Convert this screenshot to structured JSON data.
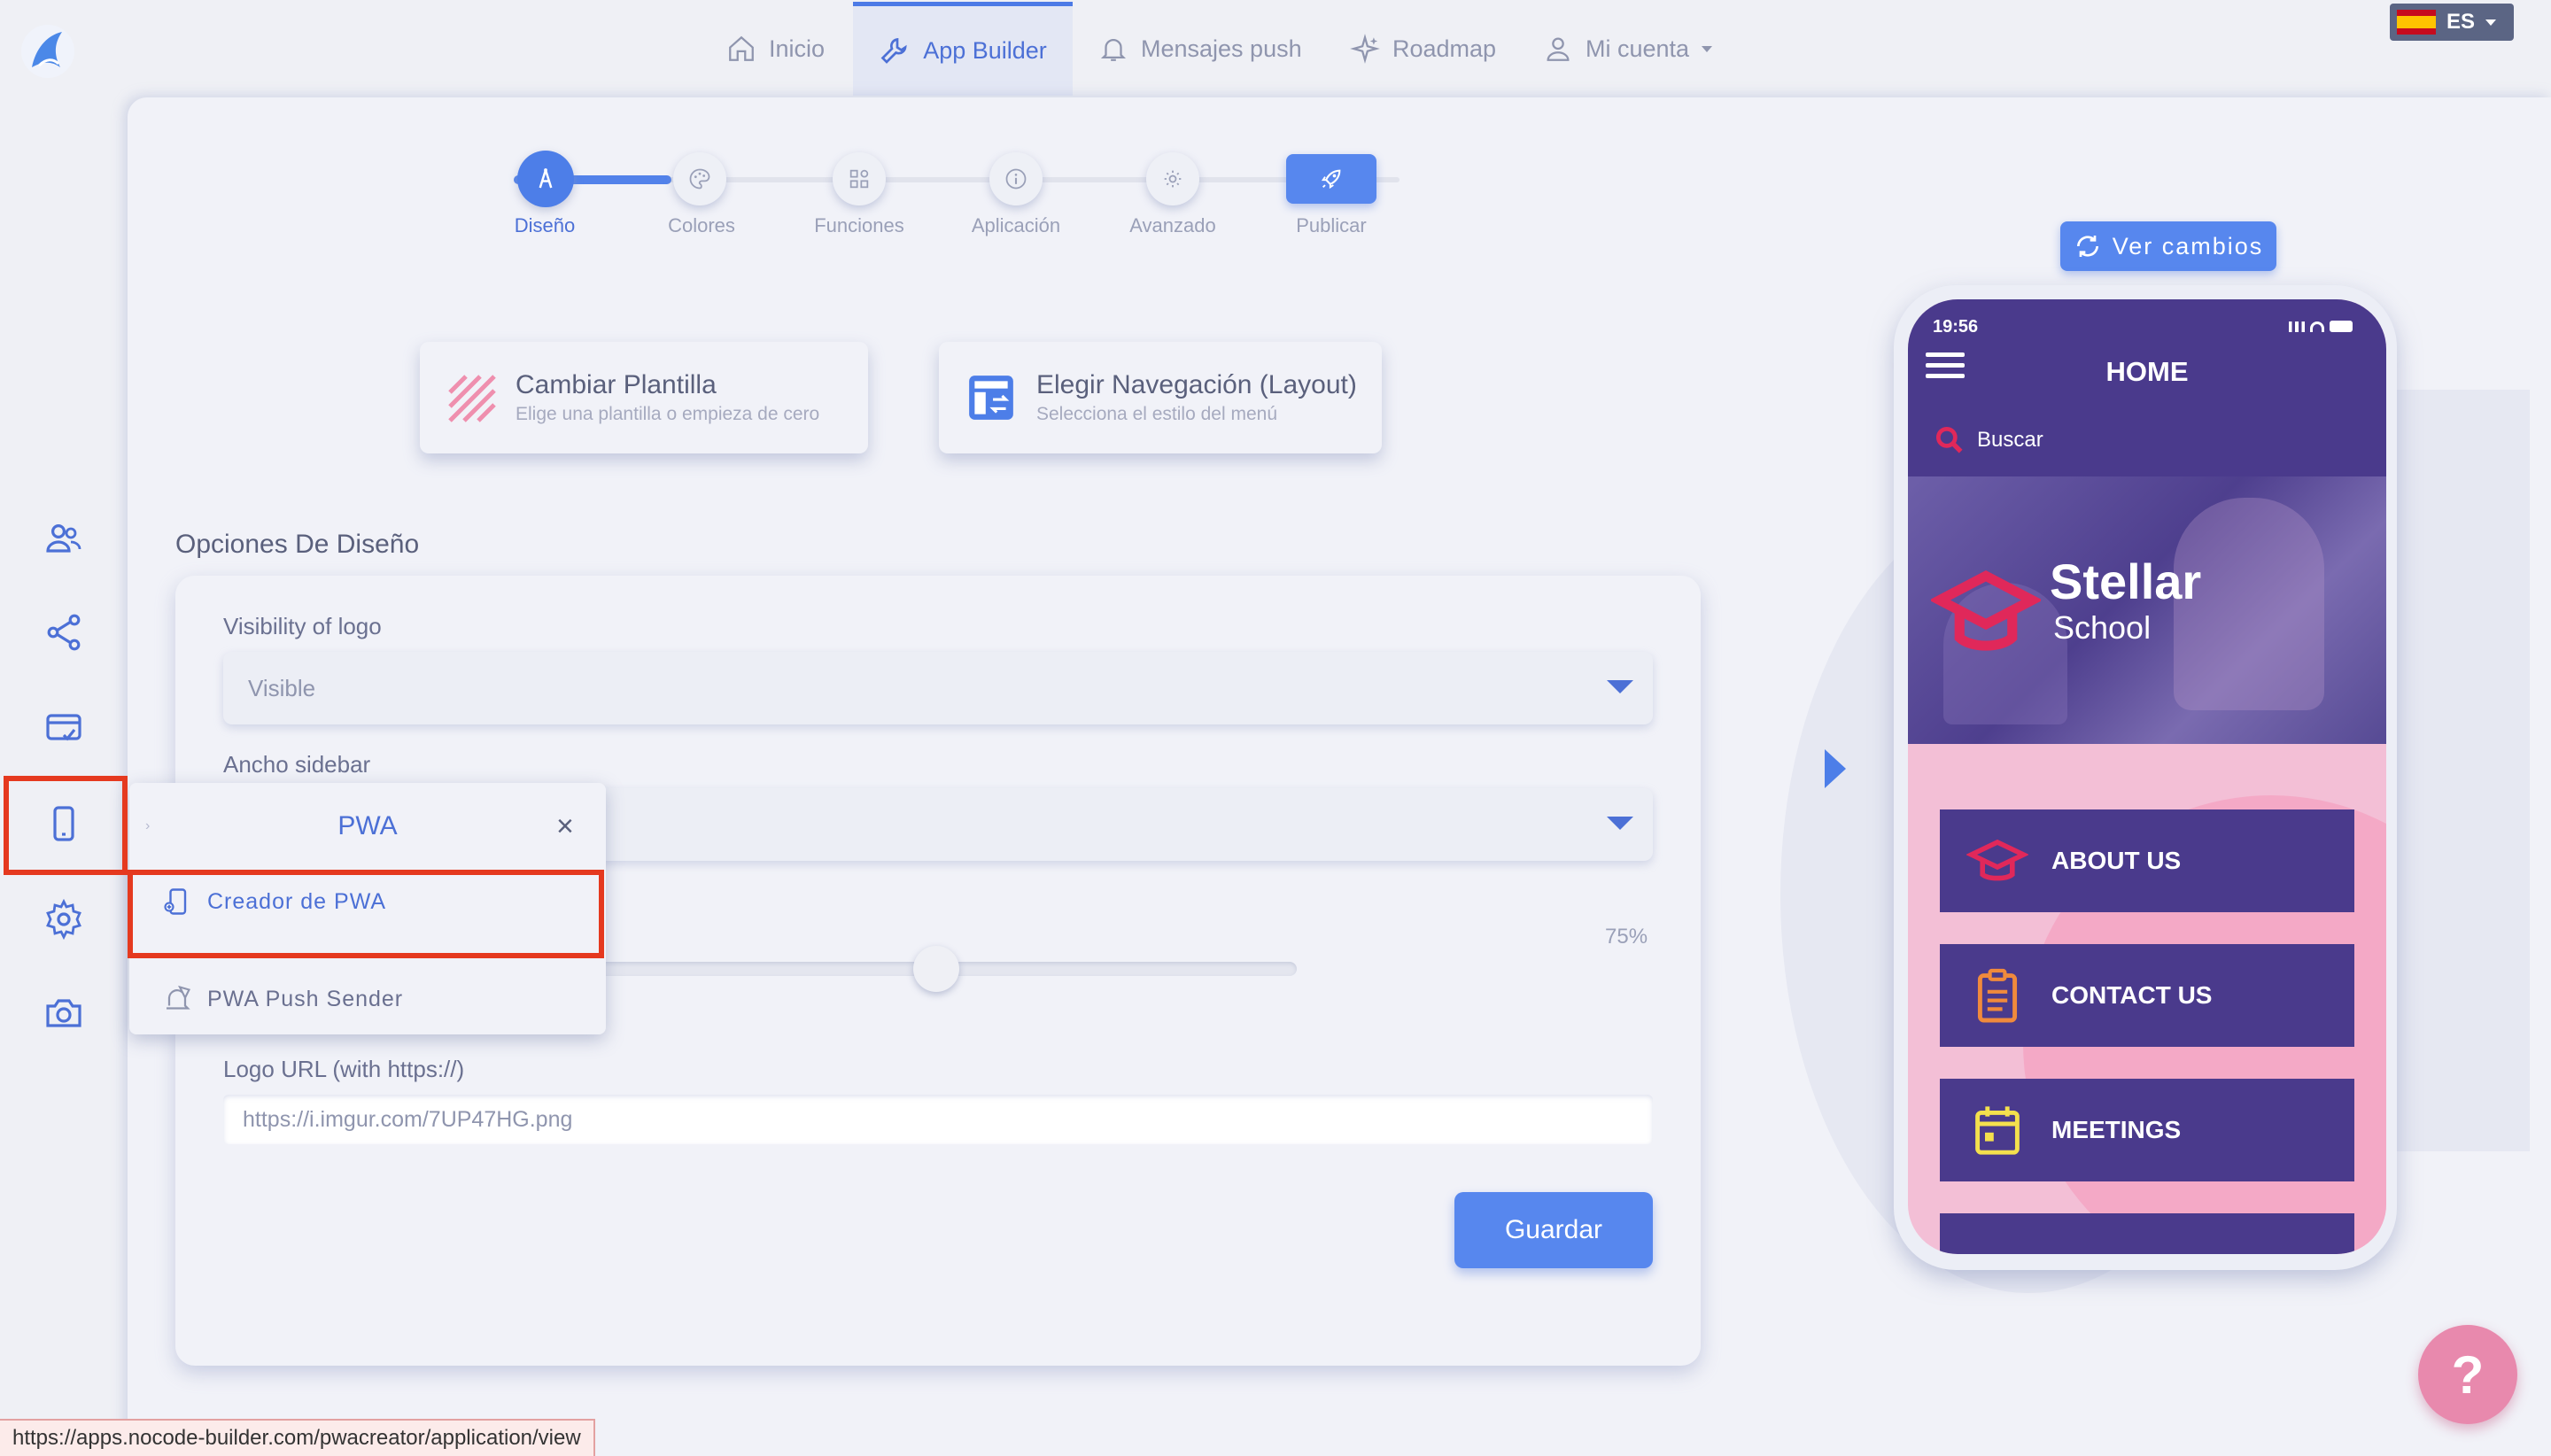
{
  "nav": {
    "items": [
      {
        "label": "Inicio",
        "icon": "home-icon"
      },
      {
        "label": "App Builder",
        "icon": "wrench-icon",
        "active": true
      },
      {
        "label": "Mensajes push",
        "icon": "bell-icon"
      },
      {
        "label": "Roadmap",
        "icon": "sparkle-icon"
      },
      {
        "label": "Mi cuenta",
        "icon": "user-icon"
      }
    ],
    "language": "ES"
  },
  "sidebar": {
    "icons": [
      "users-icon",
      "share-icon",
      "card-icon",
      "mobile-icon",
      "gear-icon",
      "camera-icon"
    ]
  },
  "steps": {
    "items": [
      {
        "label": "Diseño",
        "icon": "compass-icon",
        "state": "active"
      },
      {
        "label": "Colores",
        "icon": "palette-icon",
        "state": "pending"
      },
      {
        "label": "Funciones",
        "icon": "grid-icon",
        "state": "pending"
      },
      {
        "label": "Aplicación",
        "icon": "info-icon",
        "state": "pending"
      },
      {
        "label": "Avanzado",
        "icon": "settings-icon",
        "state": "pending"
      },
      {
        "label": "Publicar",
        "icon": "rocket-icon",
        "state": "publish"
      }
    ]
  },
  "cards": {
    "template": {
      "title": "Cambiar Plantilla",
      "subtitle": "Elige una plantilla o empieza de cero"
    },
    "layout": {
      "title": "Elegir Navegación (Layout)",
      "subtitle": "Selecciona el estilo del menú"
    }
  },
  "form": {
    "section_title": "Opciones De Diseño",
    "logo_visibility_label": "Visibility of logo",
    "logo_visibility_value": "Visible",
    "sidebar_width_label": "Ancho sidebar",
    "logo_size_value": "75%",
    "logo_size_fraction": 0.5,
    "logo_url_label": "Logo URL (with https://)",
    "logo_url_value": "https://i.imgur.com/7UP47HG.png",
    "save_label": "Guardar"
  },
  "popup": {
    "title": "PWA",
    "close": "×",
    "items": [
      {
        "label": "Creador de PWA",
        "icon": "pwa-builder-icon",
        "highlighted": true
      },
      {
        "label": "PWA Push Sender",
        "icon": "push-send-icon"
      }
    ]
  },
  "preview": {
    "ver_cambios_label": "Ver cambios",
    "time": "19:56",
    "header_title": "HOME",
    "search_label": "Buscar",
    "brand_title": "Stellar",
    "brand_subtitle": "School",
    "menu": [
      {
        "label": "ABOUT US",
        "icon": "graduation-cap-icon",
        "color": "#e0285a"
      },
      {
        "label": "CONTACT US",
        "icon": "clipboard-icon",
        "color": "#f08a3c"
      },
      {
        "label": "MEETINGS",
        "icon": "calendar-icon",
        "color": "#f4e04d"
      }
    ]
  },
  "help_label": "?",
  "status_url": "https://apps.nocode-builder.com/pwacreator/application/view",
  "colors": {
    "accent": "#5787ee",
    "phone_header": "#4a3a8c",
    "phone_background": "#f3bfd6",
    "highlight_red": "#e5391f",
    "help_button": "#e889ad"
  }
}
